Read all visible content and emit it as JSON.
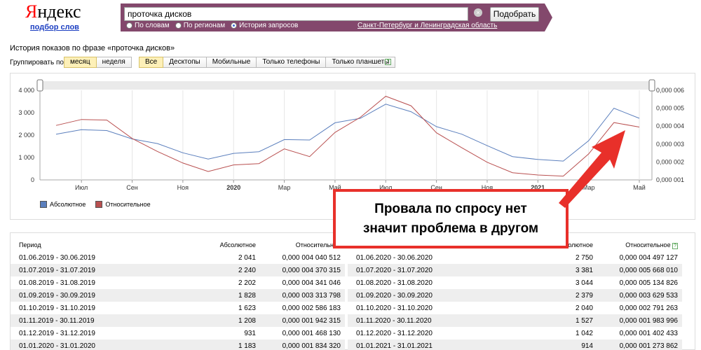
{
  "header": {
    "logo_ya": "Я",
    "logo_rest": "ндекс",
    "logo_sub": "подбор слов",
    "search_value": "проточка дисков",
    "search_button": "Подобрать",
    "radios": [
      {
        "label": "По словам",
        "checked": false
      },
      {
        "label": "По регионам",
        "checked": false
      },
      {
        "label": "История запросов",
        "checked": true
      }
    ],
    "region": "Санкт-Петербург и Ленинградская область"
  },
  "history": {
    "title": "История показов по фразе «проточка дисков»",
    "group_label": "Группировать по:",
    "period_buttons": [
      {
        "label": "месяц",
        "active": true
      },
      {
        "label": "неделя",
        "active": false
      }
    ],
    "device_buttons": [
      {
        "label": "Все",
        "active": true
      },
      {
        "label": "Десктопы",
        "active": false
      },
      {
        "label": "Мобильные",
        "active": false
      },
      {
        "label": "Только телефоны",
        "active": false
      },
      {
        "label": "Только планшеты",
        "active": false
      }
    ],
    "help": "?"
  },
  "chart_data": {
    "type": "line",
    "x_ticks": [
      "Июл",
      "Сен",
      "Ноя",
      "2020",
      "Мар",
      "Май",
      "Июл",
      "Сен",
      "Ноя",
      "2021",
      "Мар",
      "Май"
    ],
    "y_left_ticks": [
      "0",
      "1 000",
      "2 000",
      "3 000",
      "4 000"
    ],
    "y_right_ticks": [
      "0,000 001",
      "0,000 002",
      "0,000 003",
      "0,000 004",
      "0,000 005",
      "0,000 006"
    ],
    "ylim_left": [
      0,
      4000
    ],
    "ylim_right": [
      1e-06,
      6e-06
    ],
    "x": [
      "2019-06",
      "2019-07",
      "2019-08",
      "2019-09",
      "2019-10",
      "2019-11",
      "2019-12",
      "2020-01",
      "2020-02",
      "2020-03",
      "2020-04",
      "2020-05",
      "2020-06",
      "2020-07",
      "2020-08",
      "2020-09",
      "2020-10",
      "2020-11",
      "2020-12",
      "2021-01",
      "2021-02",
      "2021-03",
      "2021-04",
      "2021-05"
    ],
    "series": [
      {
        "name": "Абсолютное",
        "color": "#5b7fbd",
        "axis": "left",
        "values": [
          2041,
          2240,
          2202,
          1828,
          1623,
          1208,
          931,
          1183,
          1260,
          1800,
          1780,
          2550,
          2750,
          3381,
          3044,
          2379,
          2040,
          1527,
          1042,
          914,
          840,
          1750,
          3200,
          2750
        ]
      },
      {
        "name": "Относительное",
        "color": "#b95050",
        "axis": "right",
        "values": [
          4.0405e-06,
          4.3703e-06,
          4.341e-06,
          3.3138e-06,
          2.5862e-06,
          1.9423e-06,
          1.4681e-06,
          1.8343e-06,
          1.91e-06,
          2.73e-06,
          2.3e-06,
          3.65e-06,
          4.4971e-06,
          5.668e-06,
          5.1348e-06,
          3.6295e-06,
          2.7913e-06,
          1.984e-06,
          1.4024e-06,
          1.2739e-06,
          1.21e-06,
          2.45e-06,
          4.2e-06,
          3.95e-06
        ]
      }
    ]
  },
  "table": {
    "headers": {
      "period": "Период",
      "abs": "Абсолютное",
      "rel": "Относительное",
      "help": "?"
    },
    "left_rows": [
      {
        "period": "01.06.2019 - 30.06.2019",
        "abs": "2 041",
        "rel": "0,000 004 040 512"
      },
      {
        "period": "01.07.2019 - 31.07.2019",
        "abs": "2 240",
        "rel": "0,000 004 370 315"
      },
      {
        "period": "01.08.2019 - 31.08.2019",
        "abs": "2 202",
        "rel": "0,000 004 341 046"
      },
      {
        "period": "01.09.2019 - 30.09.2019",
        "abs": "1 828",
        "rel": "0,000 003 313 798"
      },
      {
        "period": "01.10.2019 - 31.10.2019",
        "abs": "1 623",
        "rel": "0,000 002 586 183"
      },
      {
        "period": "01.11.2019 - 30.11.2019",
        "abs": "1 208",
        "rel": "0,000 001 942 315"
      },
      {
        "period": "01.12.2019 - 31.12.2019",
        "abs": "931",
        "rel": "0,000 001 468 130"
      },
      {
        "period": "01.01.2020 - 31.01.2020",
        "abs": "1 183",
        "rel": "0,000 001 834 320"
      }
    ],
    "right_rows": [
      {
        "period": "01.06.2020 - 30.06.2020",
        "abs": "2 750",
        "rel": "0,000 004 497 127"
      },
      {
        "period": "01.07.2020 - 31.07.2020",
        "abs": "3 381",
        "rel": "0,000 005 668 010"
      },
      {
        "period": "01.08.2020 - 31.08.2020",
        "abs": "3 044",
        "rel": "0,000 005 134 826"
      },
      {
        "period": "01.09.2020 - 30.09.2020",
        "abs": "2 379",
        "rel": "0,000 003 629 533"
      },
      {
        "period": "01.10.2020 - 31.10.2020",
        "abs": "2 040",
        "rel": "0,000 002 791 263"
      },
      {
        "period": "01.11.2020 - 30.11.2020",
        "abs": "1 527",
        "rel": "0,000 001 983 996"
      },
      {
        "period": "01.12.2020 - 31.12.2020",
        "abs": "1 042",
        "rel": "0,000 001 402 433"
      },
      {
        "period": "01.01.2021 - 31.01.2021",
        "abs": "914",
        "rel": "0,000 001 273 862"
      }
    ]
  },
  "callout": {
    "line1": "Провала по спросу нет",
    "line2": "значит проблема в другом",
    "color": "#e8302a"
  }
}
